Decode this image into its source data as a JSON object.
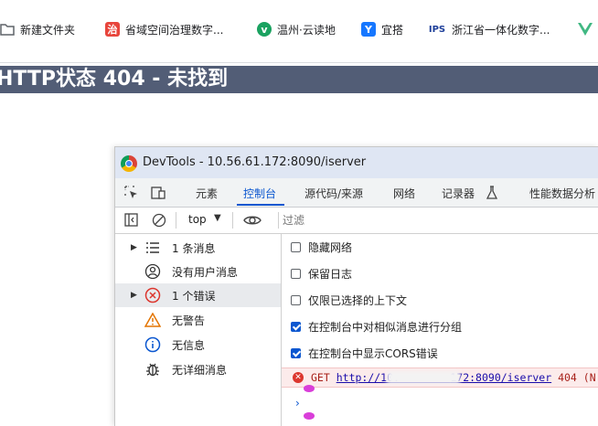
{
  "bookmarks": [
    {
      "label": "新建文件夹",
      "icon": "folder-icon",
      "color": "#5f6368"
    },
    {
      "label": "省域空间治理数字...",
      "icon": "zhi-icon",
      "color": "#e8453c"
    },
    {
      "label": "温州·云读地",
      "icon": "leaf-icon",
      "color": "#1aa260"
    },
    {
      "label": "宜搭",
      "icon": "yida-icon",
      "color": "#1677ff"
    },
    {
      "label": "浙江省一体化数字...",
      "icon": "ips-icon",
      "color": "#1e3f9a"
    }
  ],
  "page": {
    "heading": "HTTP状态 404 - 未找到",
    "header_color": "#525d76"
  },
  "devtools": {
    "title": "DevTools - 10.56.61.172:8090/iserver",
    "tabs": [
      {
        "label": "元素"
      },
      {
        "label": "控制台"
      },
      {
        "label": "源代码/来源"
      },
      {
        "label": "网络"
      },
      {
        "label": "记录器"
      },
      {
        "label": "性能数据分析"
      }
    ],
    "active_tab": "控制台",
    "toolbar": {
      "context": "top",
      "filter_placeholder": "过滤"
    },
    "sidebar": [
      {
        "label": "1 条消息"
      },
      {
        "label": "没有用户消息"
      },
      {
        "label": "1 个错误"
      },
      {
        "label": "无警告"
      },
      {
        "label": "无信息"
      },
      {
        "label": "无详细消息"
      }
    ],
    "settings": [
      {
        "label": "隐藏网络",
        "checked": false
      },
      {
        "label": "保留日志",
        "checked": false
      },
      {
        "label": "仅限已选择的上下文",
        "checked": false
      },
      {
        "label": "在控制台中对相似消息进行分组",
        "checked": true
      },
      {
        "label": "在控制台中显示CORS错误",
        "checked": true
      }
    ],
    "error": {
      "method": "GET",
      "url_start": "http://10.",
      "url_end": "172:8090/iserver",
      "status": "404 (N"
    },
    "prompt_symbol": "›"
  }
}
